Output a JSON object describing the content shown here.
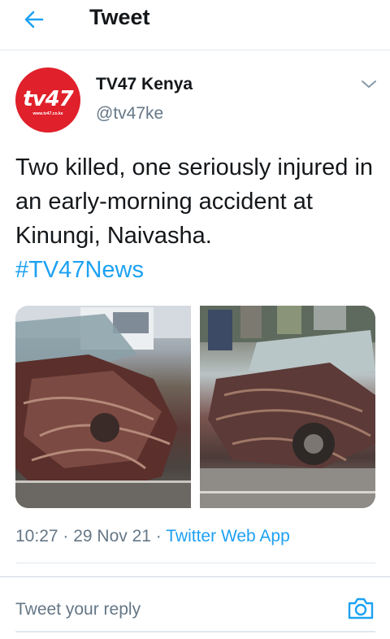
{
  "header": {
    "title": "Tweet",
    "back_icon": "arrow-left-icon"
  },
  "tweet": {
    "author": {
      "display_name": "TV47 Kenya",
      "handle": "@tv47ke",
      "avatar": {
        "logo_text": "tv47",
        "url_text": "www.tv47.co.ke",
        "background": "#e0202a"
      }
    },
    "text": "Two killed, one seriously injured in an early-morning accident at Kinungi, Naivasha.",
    "hashtag": "#TV47News",
    "media": [
      {
        "name": "accident-photo-1"
      },
      {
        "name": "accident-photo-2"
      }
    ],
    "meta": {
      "time": "10:27",
      "separator": " · ",
      "date": "29 Nov 21",
      "source": "Twitter Web App"
    }
  },
  "reply": {
    "placeholder": "Tweet your reply",
    "camera_icon": "camera-icon"
  },
  "colors": {
    "accent": "#1da1f2",
    "text_primary": "#14171a",
    "text_secondary": "#657786",
    "divider": "#e1e8ed"
  }
}
